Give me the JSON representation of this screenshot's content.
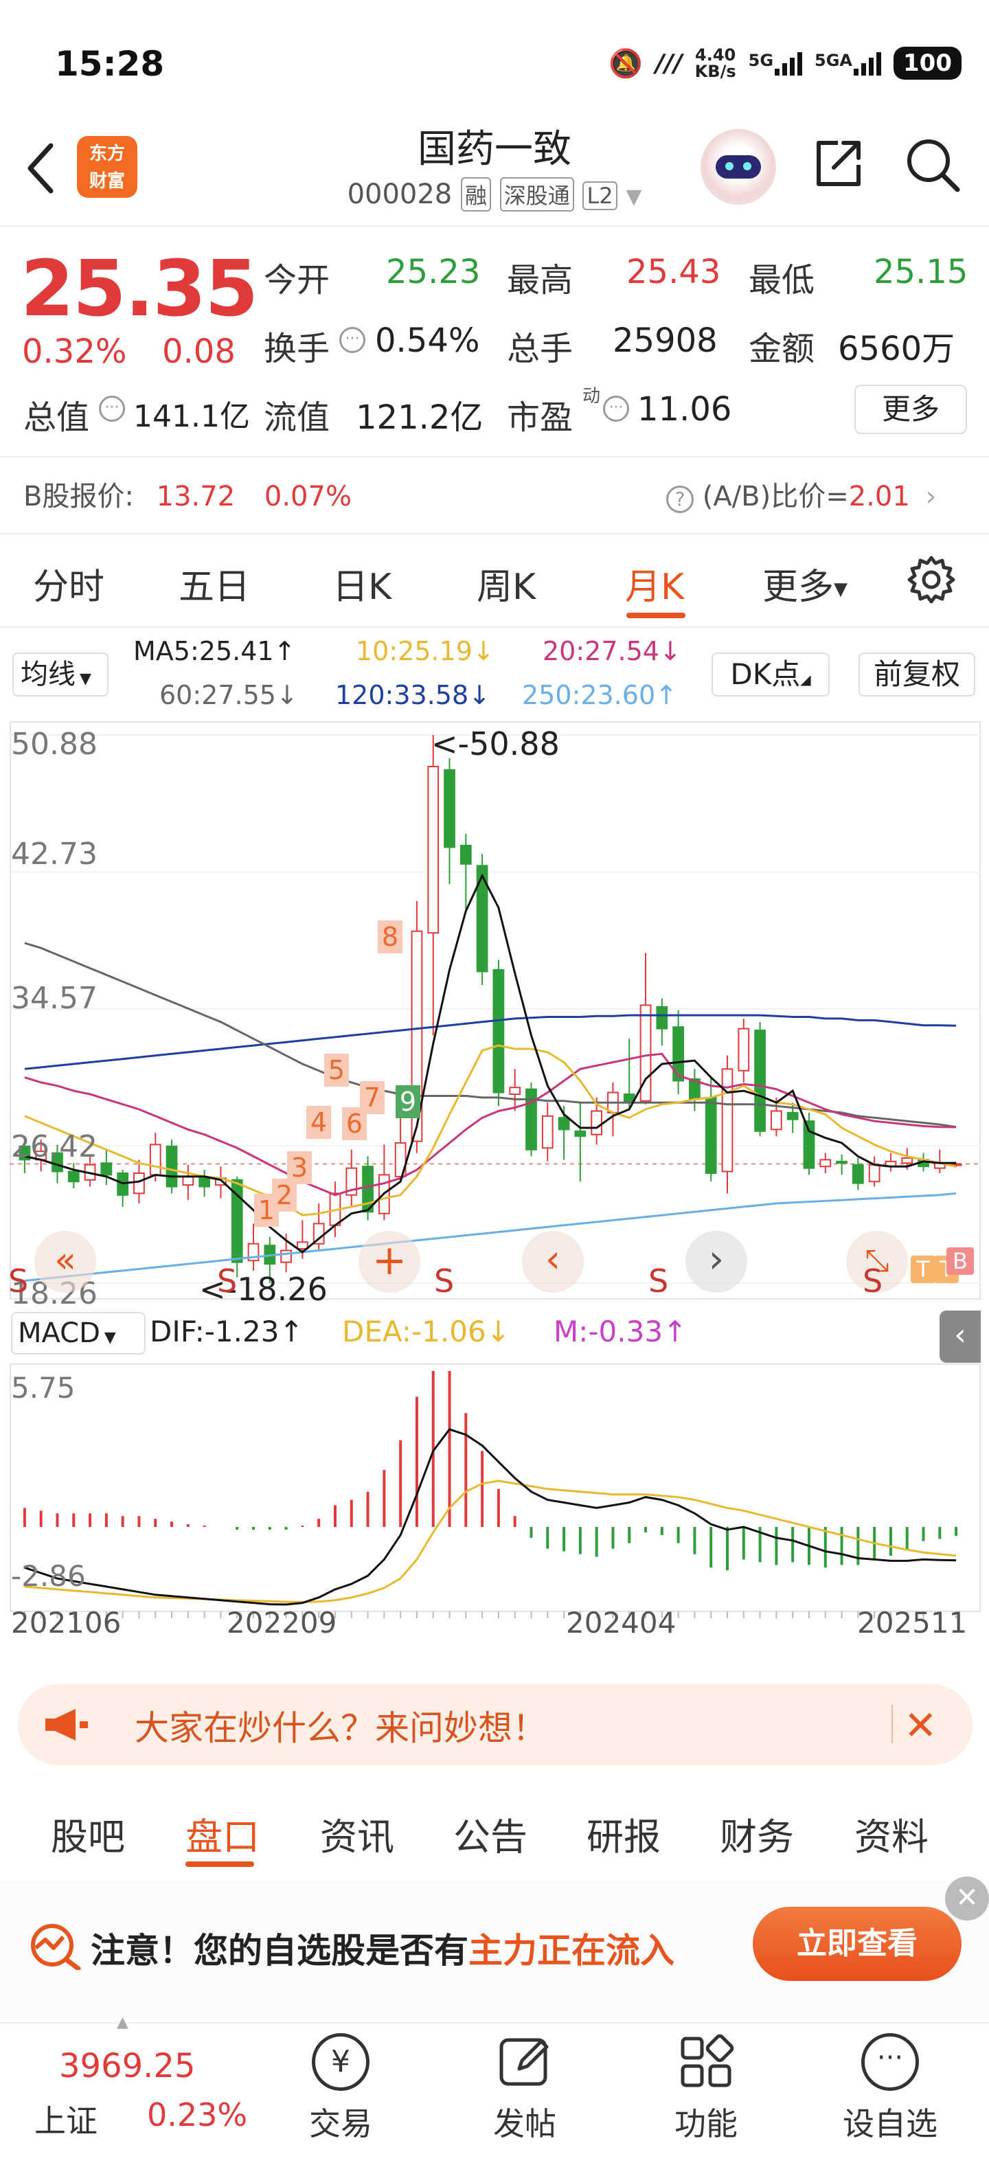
{
  "status_bar": {
    "time": "15:28",
    "speed": "4.40",
    "speed_unit": "KB/s",
    "net1": "5G",
    "net2": "5GA",
    "battery": "100"
  },
  "header": {
    "brand": "东方财富",
    "title": "国药一致",
    "code": "000028",
    "tags": [
      "融",
      "深股通",
      "L2"
    ]
  },
  "quote": {
    "price": "25.35",
    "change_pct": "0.32%",
    "change_amt": "0.08",
    "open_label": "今开",
    "open": "25.23",
    "high_label": "最高",
    "high": "25.43",
    "low_label": "最低",
    "low": "25.15",
    "turnover_label": "换手",
    "turnover": "0.54%",
    "volume_label": "总手",
    "volume": "25908",
    "amount_label": "金额",
    "amount": "6560万",
    "mcap_label": "总值",
    "mcap": "141.1亿",
    "float_label": "流值",
    "float": "121.2亿",
    "pe_label": "市盈",
    "pe_sup": "动",
    "pe": "11.06",
    "more": "更多"
  },
  "bshare": {
    "label": "B股报价:",
    "price": "13.72",
    "pct": "0.07%",
    "ratio_label": "(A/B)比价=",
    "ratio": "2.01"
  },
  "tabs": [
    "分时",
    "五日",
    "日K",
    "周K",
    "月K",
    "更多"
  ],
  "active_tab": "月K",
  "ma": {
    "select": "均线",
    "ma5": "MA5:25.41",
    "ma10": "10:25.19",
    "ma20": "20:27.54",
    "ma60": "60:27.55",
    "ma120": "120:33.58",
    "ma250": "250:23.60",
    "dk": "DK点",
    "fq": "前复权"
  },
  "kline": {
    "y_ticks": [
      "50.88",
      "42.73",
      "34.57",
      "26.42",
      "18.26"
    ],
    "max_label": "<-50.88",
    "min_label": "<-18.26",
    "macd_select": "MACD",
    "dif": "DIF:-1.23",
    "dea": "DEA:-1.06",
    "m": "M:-0.33",
    "macd_ticks": [
      "5.75",
      "-2.86"
    ],
    "x_labels": [
      "202106",
      "202209",
      "202404",
      "202511"
    ],
    "markers": [
      "1",
      "2",
      "3",
      "4",
      "5",
      "6",
      "7",
      "8",
      "9"
    ],
    "s_marker": "S"
  },
  "colors": {
    "up": "#e03a3a",
    "down": "#2e9e3a",
    "accent": "#e7541e",
    "ma5": "#111111",
    "ma10": "#e8b830",
    "ma20": "#c8357a",
    "ma60": "#666666",
    "ma120": "#1f3fa0",
    "ma250": "#6aaee6"
  },
  "chart_data": {
    "type": "candlestick",
    "title": "",
    "period": "monthly",
    "candles": [
      {
        "o": 26.4,
        "c": 25.6,
        "h": 27.0,
        "l": 24.8
      },
      {
        "o": 25.6,
        "c": 26.1,
        "h": 26.8,
        "l": 24.9
      },
      {
        "o": 26.0,
        "c": 24.9,
        "h": 26.5,
        "l": 24.2
      },
      {
        "o": 24.9,
        "c": 24.3,
        "h": 25.4,
        "l": 23.9
      },
      {
        "o": 24.4,
        "c": 25.3,
        "h": 25.9,
        "l": 24.0
      },
      {
        "o": 25.4,
        "c": 24.7,
        "h": 26.2,
        "l": 24.1
      },
      {
        "o": 24.8,
        "c": 23.5,
        "h": 25.0,
        "l": 22.8
      },
      {
        "o": 23.6,
        "c": 24.8,
        "h": 25.6,
        "l": 23.0
      },
      {
        "o": 24.7,
        "c": 26.5,
        "h": 27.2,
        "l": 24.3
      },
      {
        "o": 26.4,
        "c": 24.0,
        "h": 26.8,
        "l": 23.6
      },
      {
        "o": 24.1,
        "c": 24.6,
        "h": 25.3,
        "l": 23.2
      },
      {
        "o": 24.5,
        "c": 24.0,
        "h": 25.0,
        "l": 23.4
      },
      {
        "o": 24.1,
        "c": 24.5,
        "h": 25.2,
        "l": 23.3
      },
      {
        "o": 24.4,
        "c": 19.5,
        "h": 24.6,
        "l": 18.6
      },
      {
        "o": 19.6,
        "c": 20.6,
        "h": 21.8,
        "l": 19.0
      },
      {
        "o": 20.5,
        "c": 19.4,
        "h": 21.0,
        "l": 18.26
      },
      {
        "o": 19.5,
        "c": 20.2,
        "h": 21.2,
        "l": 18.9
      },
      {
        "o": 20.3,
        "c": 20.7,
        "h": 22.0,
        "l": 19.7
      },
      {
        "o": 20.6,
        "c": 21.8,
        "h": 23.0,
        "l": 20.2
      },
      {
        "o": 21.7,
        "c": 23.6,
        "h": 24.3,
        "l": 21.0
      },
      {
        "o": 23.5,
        "c": 25.1,
        "h": 26.2,
        "l": 22.8
      },
      {
        "o": 25.2,
        "c": 22.5,
        "h": 25.8,
        "l": 22.0
      },
      {
        "o": 22.4,
        "c": 24.7,
        "h": 26.5,
        "l": 22.0
      },
      {
        "o": 24.6,
        "c": 26.6,
        "h": 29.8,
        "l": 24.3
      },
      {
        "o": 26.7,
        "c": 39.2,
        "h": 41.0,
        "l": 26.0
      },
      {
        "o": 39.1,
        "c": 49.0,
        "h": 50.88,
        "l": 33.0
      },
      {
        "o": 48.8,
        "c": 44.2,
        "h": 49.5,
        "l": 42.0
      },
      {
        "o": 44.3,
        "c": 43.2,
        "h": 45.0,
        "l": 40.3
      },
      {
        "o": 43.1,
        "c": 36.8,
        "h": 43.8,
        "l": 36.0
      },
      {
        "o": 36.9,
        "c": 29.6,
        "h": 37.5,
        "l": 28.8
      },
      {
        "o": 29.5,
        "c": 29.9,
        "h": 31.0,
        "l": 28.5
      },
      {
        "o": 29.8,
        "c": 26.2,
        "h": 30.2,
        "l": 25.8
      },
      {
        "o": 26.3,
        "c": 28.2,
        "h": 29.0,
        "l": 25.5
      },
      {
        "o": 28.1,
        "c": 27.4,
        "h": 28.8,
        "l": 25.6
      },
      {
        "o": 27.3,
        "c": 27.0,
        "h": 29.0,
        "l": 24.3
      },
      {
        "o": 27.1,
        "c": 28.5,
        "h": 29.3,
        "l": 26.5
      },
      {
        "o": 28.4,
        "c": 29.6,
        "h": 30.2,
        "l": 27.0
      },
      {
        "o": 29.5,
        "c": 29.0,
        "h": 32.8,
        "l": 28.6
      },
      {
        "o": 29.1,
        "c": 34.8,
        "h": 37.9,
        "l": 28.9
      },
      {
        "o": 34.7,
        "c": 33.4,
        "h": 35.2,
        "l": 32.4
      },
      {
        "o": 33.5,
        "c": 30.3,
        "h": 34.5,
        "l": 29.5
      },
      {
        "o": 30.4,
        "c": 29.2,
        "h": 31.0,
        "l": 28.5
      },
      {
        "o": 29.3,
        "c": 24.8,
        "h": 30.5,
        "l": 24.3
      },
      {
        "o": 24.9,
        "c": 31.0,
        "h": 31.8,
        "l": 23.6
      },
      {
        "o": 30.9,
        "c": 33.4,
        "h": 34.0,
        "l": 30.2
      },
      {
        "o": 33.3,
        "c": 27.3,
        "h": 33.8,
        "l": 27.0
      },
      {
        "o": 27.4,
        "c": 28.5,
        "h": 29.3,
        "l": 27.0
      },
      {
        "o": 28.4,
        "c": 28.0,
        "h": 29.0,
        "l": 27.2
      },
      {
        "o": 27.9,
        "c": 25.1,
        "h": 28.4,
        "l": 24.7
      },
      {
        "o": 25.2,
        "c": 25.6,
        "h": 26.0,
        "l": 24.8
      },
      {
        "o": 25.5,
        "c": 25.4,
        "h": 25.9,
        "l": 24.7
      },
      {
        "o": 25.3,
        "c": 24.2,
        "h": 25.7,
        "l": 23.8
      },
      {
        "o": 24.3,
        "c": 25.3,
        "h": 25.8,
        "l": 24.0
      },
      {
        "o": 25.2,
        "c": 25.5,
        "h": 26.0,
        "l": 24.9
      },
      {
        "o": 25.4,
        "c": 25.7,
        "h": 26.3,
        "l": 25.0
      },
      {
        "o": 25.6,
        "c": 25.2,
        "h": 26.0,
        "l": 24.9
      },
      {
        "o": 25.1,
        "c": 25.4,
        "h": 26.2,
        "l": 24.8
      },
      {
        "o": 25.3,
        "c": 25.35,
        "h": 25.43,
        "l": 25.15
      }
    ],
    "ma5": [
      25.8,
      25.6,
      25.3,
      25.0,
      24.8,
      24.6,
      24.2,
      24.3,
      24.7,
      24.6,
      24.6,
      24.6,
      24.4,
      23.5,
      22.6,
      21.6,
      20.8,
      20.1,
      20.9,
      21.7,
      22.4,
      22.6,
      23.6,
      24.3,
      27.6,
      32.5,
      36.9,
      40.4,
      42.5,
      40.6,
      36.7,
      33.0,
      30.0,
      28.3,
      27.5,
      27.5,
      28.2,
      28.6,
      30.4,
      31.3,
      31.4,
      31.5,
      30.5,
      29.6,
      29.7,
      29.4,
      29.0,
      29.7,
      27.3,
      26.9,
      26.6,
      25.8,
      25.3,
      25.2,
      25.2,
      25.5,
      25.4,
      25.41
    ],
    "ma10": [
      28.2,
      27.8,
      27.4,
      27.0,
      26.6,
      26.2,
      25.8,
      25.4,
      25.2,
      25.0,
      24.8,
      24.6,
      24.5,
      24.2,
      23.8,
      23.4,
      22.9,
      22.3,
      22.4,
      22.6,
      22.8,
      23.0,
      23.3,
      23.5,
      24.6,
      26.3,
      28.3,
      30.2,
      32.1,
      32.4,
      32.2,
      32.2,
      32.0,
      31.4,
      30.3,
      28.9,
      28.4,
      28.1,
      28.6,
      28.9,
      29.0,
      29.2,
      29.3,
      29.6,
      30.0,
      29.4,
      29.0,
      28.9,
      28.6,
      28.3,
      27.5,
      27.0,
      26.5,
      26.1,
      25.8,
      25.6,
      25.4,
      25.19
    ],
    "ma20": [
      30.5,
      30.2,
      30.0,
      29.7,
      29.5,
      29.2,
      28.9,
      28.6,
      28.2,
      27.8,
      27.4,
      27.1,
      26.7,
      26.3,
      25.8,
      25.3,
      24.8,
      24.3,
      23.9,
      23.5,
      23.8,
      24.0,
      24.2,
      24.5,
      25.0,
      25.8,
      26.6,
      27.4,
      28.1,
      28.5,
      28.7,
      29.0,
      29.6,
      30.3,
      31.0,
      31.2,
      31.4,
      31.6,
      31.8,
      31.9,
      30.6,
      30.3,
      30.0,
      29.9,
      30.1,
      30.0,
      29.8,
      29.4,
      29.0,
      28.6,
      28.3,
      28.1,
      27.9,
      27.8,
      27.7,
      27.6,
      27.55,
      27.54
    ],
    "ma60": [
      38.5,
      38.2,
      37.8,
      37.4,
      37.0,
      36.6,
      36.2,
      35.8,
      35.4,
      35.0,
      34.6,
      34.2,
      33.8,
      33.3,
      32.8,
      32.3,
      31.8,
      31.3,
      30.9,
      30.5,
      30.2,
      29.9,
      29.7,
      29.5,
      29.4,
      29.4,
      29.4,
      29.4,
      29.3,
      29.3,
      29.2,
      29.2,
      29.1,
      29.1,
      29.0,
      29.0,
      29.0,
      29.0,
      29.0,
      29.0,
      29.0,
      29.0,
      29.0,
      28.9,
      28.9,
      28.9,
      28.8,
      28.7,
      28.6,
      28.5,
      28.4,
      28.2,
      28.1,
      28.0,
      27.9,
      27.8,
      27.7,
      27.55
    ],
    "ma120": [
      31.0,
      31.1,
      31.2,
      31.3,
      31.4,
      31.5,
      31.6,
      31.7,
      31.8,
      31.9,
      32.0,
      32.1,
      32.2,
      32.3,
      32.4,
      32.5,
      32.6,
      32.7,
      32.8,
      32.9,
      33.0,
      33.1,
      33.2,
      33.3,
      33.4,
      33.5,
      33.6,
      33.7,
      33.8,
      33.9,
      34.0,
      34.05,
      34.1,
      34.1,
      34.1,
      34.15,
      34.15,
      34.2,
      34.2,
      34.2,
      34.2,
      34.2,
      34.2,
      34.2,
      34.2,
      34.2,
      34.15,
      34.1,
      34.1,
      34.0,
      34.0,
      33.9,
      33.9,
      33.8,
      33.7,
      33.6,
      33.6,
      33.58
    ],
    "ma250": [
      18.4,
      18.5,
      18.6,
      18.7,
      18.8,
      18.9,
      19.0,
      19.1,
      19.2,
      19.3,
      19.4,
      19.5,
      19.6,
      19.7,
      19.8,
      19.9,
      20.0,
      20.1,
      20.2,
      20.3,
      20.4,
      20.5,
      20.6,
      20.7,
      20.8,
      20.9,
      21.0,
      21.1,
      21.2,
      21.3,
      21.4,
      21.5,
      21.6,
      21.7,
      21.8,
      21.9,
      22.0,
      22.1,
      22.2,
      22.3,
      22.4,
      22.5,
      22.6,
      22.7,
      22.8,
      22.9,
      23.0,
      23.05,
      23.1,
      23.15,
      23.2,
      23.25,
      23.3,
      23.35,
      23.4,
      23.45,
      23.5,
      23.6
    ],
    "y_range": [
      18.26,
      50.88
    ],
    "macd": {
      "dif": [
        -1.5,
        -1.7,
        -1.9,
        -2.0,
        -2.1,
        -2.2,
        -2.3,
        -2.4,
        -2.5,
        -2.55,
        -2.6,
        -2.65,
        -2.7,
        -2.75,
        -2.8,
        -2.85,
        -2.86,
        -2.8,
        -2.6,
        -2.3,
        -2.1,
        -1.8,
        -1.2,
        -0.3,
        1.2,
        2.8,
        3.6,
        3.4,
        3.0,
        2.4,
        1.8,
        1.3,
        1.0,
        0.9,
        0.8,
        0.7,
        0.8,
        0.9,
        1.1,
        1.0,
        0.8,
        0.5,
        0.1,
        -0.1,
        0.0,
        -0.2,
        -0.4,
        -0.5,
        -0.7,
        -0.9,
        -1.0,
        -1.15,
        -1.2,
        -1.25,
        -1.25,
        -1.2,
        -1.22,
        -1.23
      ],
      "dea": [
        -2.2,
        -2.25,
        -2.3,
        -2.35,
        -2.4,
        -2.45,
        -2.5,
        -2.55,
        -2.6,
        -2.62,
        -2.64,
        -2.66,
        -2.68,
        -2.7,
        -2.72,
        -2.74,
        -2.76,
        -2.77,
        -2.75,
        -2.7,
        -2.6,
        -2.45,
        -2.25,
        -1.9,
        -1.2,
        -0.2,
        0.7,
        1.3,
        1.6,
        1.7,
        1.6,
        1.5,
        1.4,
        1.35,
        1.3,
        1.25,
        1.2,
        1.2,
        1.2,
        1.15,
        1.1,
        1.0,
        0.85,
        0.7,
        0.6,
        0.45,
        0.3,
        0.15,
        0.0,
        -0.15,
        -0.3,
        -0.45,
        -0.6,
        -0.72,
        -0.84,
        -0.94,
        -1.0,
        -1.06
      ],
      "m": [
        0.7,
        0.6,
        0.5,
        0.5,
        0.5,
        0.5,
        0.4,
        0.4,
        0.3,
        0.2,
        0.1,
        0.05,
        0.0,
        -0.1,
        -0.1,
        -0.1,
        -0.1,
        0.05,
        0.3,
        0.8,
        1.0,
        1.3,
        2.1,
        3.2,
        4.8,
        5.75,
        5.75,
        4.2,
        2.8,
        1.4,
        0.4,
        -0.4,
        -0.8,
        -0.9,
        -1.0,
        -1.1,
        -0.8,
        -0.6,
        -0.2,
        -0.3,
        -0.6,
        -1.0,
        -1.5,
        -1.6,
        -1.2,
        -1.3,
        -1.4,
        -1.3,
        -1.4,
        -1.5,
        -1.4,
        -1.4,
        -1.2,
        -1.06,
        -0.82,
        -0.52,
        -0.44,
        -0.33
      ],
      "range": [
        -2.86,
        5.75
      ]
    }
  },
  "ask_banner": {
    "text": "大家在炒什么？来问妙想！"
  },
  "bottom_tabs": [
    "股吧",
    "盘口",
    "资讯",
    "公告",
    "研报",
    "财务",
    "资料"
  ],
  "active_bottom_tab": "盘口",
  "alert": {
    "prefix": "注意！您的自选股是否有",
    "highlight": "主力正在流入",
    "button": "立即查看"
  },
  "index": {
    "value": "3969.25",
    "name": "上证",
    "pct": "0.23%"
  },
  "nav": [
    "交易",
    "发帖",
    "功能",
    "设自选"
  ]
}
